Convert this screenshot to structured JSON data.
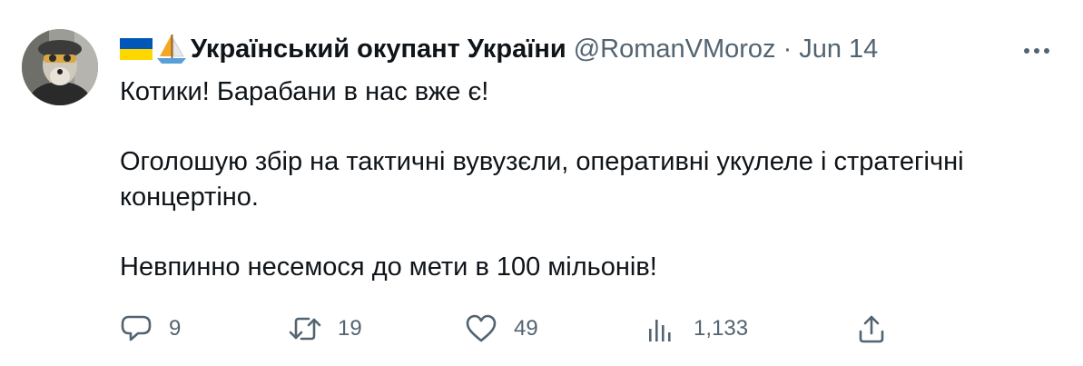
{
  "tweet": {
    "author_name": "Український окупант України",
    "author_handle": "@RomanVMoroz",
    "separator": "·",
    "date": "Jun 14",
    "flag_icon": "ukraine-flag-icon",
    "sailboat_icon": "sailboat-icon",
    "text_lines": [
      "Котики! Барабани в нас вже є!",
      "Оголошую збір на тактичні вувузєли, оперативні укулеле і стратегічні концертіно.",
      "Невпинно несемося до мети в 100 мільонів!"
    ]
  },
  "actions": {
    "reply_count": "9",
    "retweet_count": "19",
    "like_count": "49",
    "views_count": "1,133"
  },
  "colors": {
    "text": "#0f1419",
    "secondary": "#536471",
    "flag_blue": "#0057b7",
    "flag_yellow": "#ffd700"
  }
}
